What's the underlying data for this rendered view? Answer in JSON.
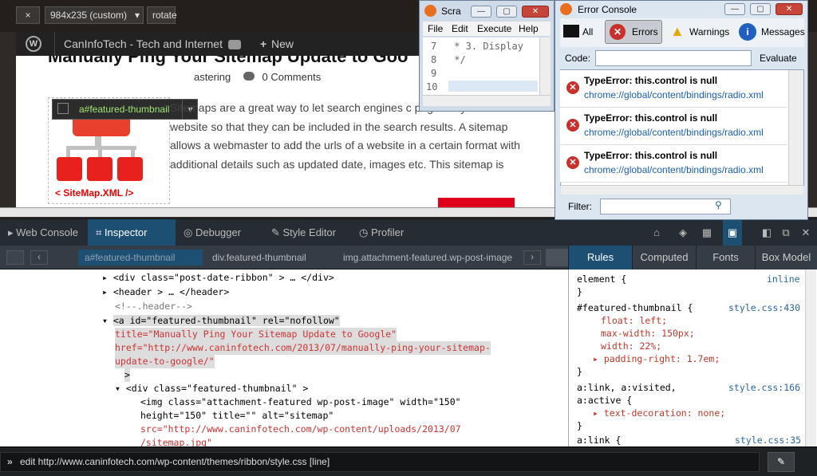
{
  "responsive": {
    "close": "×",
    "preset": "984x235 (custom)",
    "rotate": "rotate"
  },
  "wpbar": {
    "site": "CanInfoTech - Tech and Internet",
    "new": "New",
    "plus": "+"
  },
  "page": {
    "title": "Manually Ping Your Sitemap Update to Goo",
    "meta_author": "astering",
    "comments": "0 Comments",
    "tooltip": "a#featured-thumbnail",
    "thumb_label": "< SiteMap.XML />",
    "article": "Sitemaps are a great way to let search engines c pages of your website so that they can be included in the search results. A sitemap allows a webmaster to add the urls of a website in a certain format with additional details such as updated date, images etc. This sitemap is"
  },
  "devtools": {
    "tabs": [
      "Web Console",
      "Inspector",
      "Debugger",
      "Style Editor",
      "Profiler"
    ],
    "breadcrumbs": [
      "a#featured-thumbnail",
      "div.featured-thumbnail",
      "img.attachment-featured.wp-post-image"
    ],
    "side_tabs": [
      "Rules",
      "Computed",
      "Fonts",
      "Box Model"
    ],
    "markup": {
      "l1": "<div class=\"post-date-ribbon\" > … </div>",
      "l2": "<header > … </header>",
      "l3": "<!--.header-->",
      "l4": "<a id=\"featured-thumbnail\" rel=\"nofollow\"",
      "l5": "title=\"Manually Ping Your Sitemap Update to Google\"",
      "l6": "href=\"http://www.caninfotech.com/2013/07/manually-ping-your-sitemap-",
      "l7": "update-to-google/\"",
      "l8": ">",
      "l9": "<div class=\"featured-thumbnail\" >",
      "l10": "<img class=\"attachment-featured wp-post-image\" width=\"150\"",
      "l11": "height=\"150\" title=\"\" alt=\"sitemap\"",
      "l12": "src=\"http://www.caninfotech.com/wp-content/uploads/2013/07",
      "l13": "/sitemap.jpg\""
    },
    "rules": {
      "r1": "element {",
      "r1src": "inline",
      "r1end": "}",
      "r2": "#featured-thumbnail {",
      "r2src": "style.css:430",
      "r2a": "float: left;",
      "r2b": "max-width: 150px;",
      "r2c": "width: 22%;",
      "r2d": "padding-right: 1.7em;",
      "r2end": "}",
      "r3a": "a:link, a:visited,",
      "r3b": "a:active {",
      "r3src": "style.css:166",
      "r3c": "text-decoration: none;",
      "r3end": "}",
      "r4": "a:link {",
      "r4src": "style.css:35"
    },
    "command": "edit http://www.caninfotech.com/wp-content/themes/ribbon/style.css [line]"
  },
  "scratchpad": {
    "title": "Scra",
    "menu": [
      "File",
      "Edit",
      "Execute",
      "Help"
    ],
    "lines": [
      "7",
      "8",
      "9",
      "10"
    ],
    "code": [
      " * 3. Display",
      " */",
      "",
      ""
    ]
  },
  "error_console": {
    "title": "Error Console",
    "filters": [
      "All",
      "Errors",
      "Warnings",
      "Messages"
    ],
    "code_label": "Code:",
    "evaluate": "Evaluate",
    "errors": [
      {
        "msg": "TypeError: this.control is null",
        "loc": "chrome://global/content/bindings/radio.xml"
      },
      {
        "msg": "TypeError: this.control is null",
        "loc": "chrome://global/content/bindings/radio.xml"
      },
      {
        "msg": "TypeError: this.control is null",
        "loc": "chrome://global/content/bindings/radio.xml"
      }
    ],
    "filter_label": "Filter:"
  }
}
